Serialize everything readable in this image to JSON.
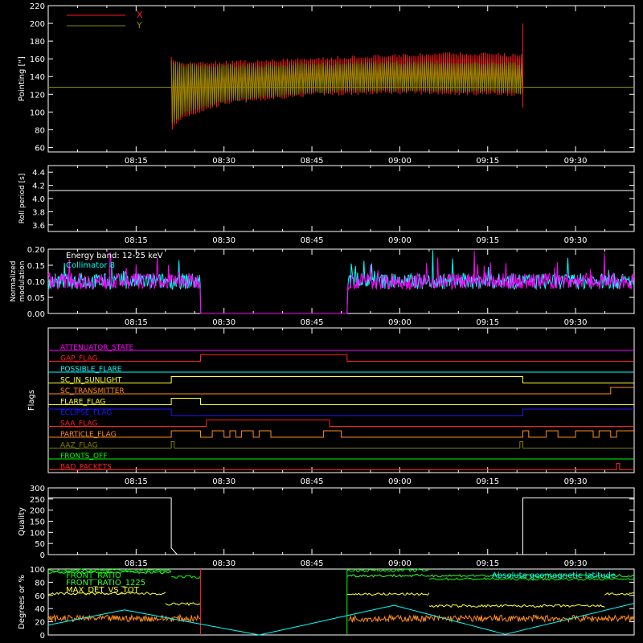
{
  "colors": {
    "background": "#000000",
    "axes": "#ffffff",
    "x_pointing": "#ff1a1a",
    "y_pointing": "#8c8c00",
    "cyan": "#00ffff",
    "magenta": "#ff00ff",
    "yellow": "#ffff33",
    "green": "#00ff00",
    "orange": "#ff8c1a",
    "red": "#ff2020",
    "blue": "#1a1aff",
    "olive": "#808000"
  },
  "time_axis": {
    "ticks": [
      "08:15",
      "08:30",
      "08:45",
      "09:00",
      "09:15",
      "09:30"
    ],
    "tick_minutes_since_08_00": [
      15,
      30,
      45,
      60,
      75,
      90
    ],
    "range_minutes": [
      0,
      100
    ]
  },
  "chart_data": [
    {
      "id": "pointing",
      "type": "line",
      "title": "",
      "xlabel": "",
      "ylabel": "Pointing [\"]",
      "ylim": [
        55,
        220
      ],
      "yticks": [
        "60",
        "80",
        "100",
        "120",
        "140",
        "160",
        "180",
        "200",
        "220"
      ],
      "ytick_values": [
        60,
        80,
        100,
        120,
        140,
        160,
        180,
        200,
        220
      ],
      "legend": "top-left",
      "reference_line": 128,
      "data_start_time": "08:21",
      "data_end_time": "09:21",
      "series": [
        {
          "name": "X",
          "color": "#ff1a1a",
          "x": [
            "08:21",
            "08:23",
            "08:30",
            "08:45",
            "09:00",
            "09:10",
            "09:21"
          ],
          "y_max": [
            162,
            158,
            158,
            162,
            166,
            168,
            166
          ],
          "y_min": [
            78,
            92,
            108,
            118,
            120,
            119,
            118
          ]
        },
        {
          "name": "Y",
          "color": "#8c8c00",
          "x": [
            "08:21",
            "08:23",
            "08:30",
            "08:45",
            "09:00",
            "09:10",
            "09:21"
          ],
          "y_max": [
            160,
            155,
            154,
            156,
            158,
            158,
            156
          ],
          "y_min": [
            84,
            96,
            110,
            120,
            122,
            121,
            120
          ]
        }
      ]
    },
    {
      "id": "roll_period",
      "type": "line",
      "title": "",
      "xlabel": "",
      "ylabel": "Roll period [s]",
      "ylim": [
        3.5,
        4.5
      ],
      "yticks": [
        "3.6",
        "3.8",
        "4.0",
        "4.2",
        "4.4"
      ],
      "ytick_values": [
        3.6,
        3.8,
        4.0,
        4.2,
        4.4
      ],
      "series": [
        {
          "name": "",
          "color": "#ffffff",
          "constant_value": 4.12
        }
      ]
    },
    {
      "id": "modulation",
      "type": "line",
      "title": "",
      "xlabel": "",
      "ylabel": "Normalized modulation",
      "ylabel_lines": [
        "Normalized",
        "modulation"
      ],
      "ylim": [
        0,
        0.2
      ],
      "yticks": [
        "0.00",
        "0.05",
        "0.10",
        "0.15",
        "0.20"
      ],
      "ytick_values": [
        0.0,
        0.05,
        0.1,
        0.15,
        0.2
      ],
      "annotations": [
        "Energy band: 12-25 keV",
        "Collimator 8"
      ],
      "gap_start": "08:26",
      "gap_end": "08:51",
      "series": [
        {
          "name": "Collimator 8",
          "color": "#00ffff",
          "mean": 0.1
        },
        {
          "name": "",
          "color": "#ff00ff",
          "mean": 0.1
        }
      ]
    },
    {
      "id": "flags",
      "type": "line",
      "title": "",
      "xlabel": "",
      "ylabel": "Flags",
      "series": [
        {
          "name": "ATTENUATOR_STATE",
          "color": "#ff00ff",
          "segments": [
            [
              "08:00",
              "09:40",
              0
            ]
          ]
        },
        {
          "name": "GAP_FLAG",
          "color": "#ff2020",
          "segments": [
            [
              "08:00",
              "08:26",
              0
            ],
            [
              "08:26",
              "08:51",
              1
            ],
            [
              "08:51",
              "09:40",
              0
            ]
          ]
        },
        {
          "name": "POSSIBLE_FLARE",
          "color": "#00ffff",
          "segments": [
            [
              "08:00",
              "09:40",
              0
            ]
          ]
        },
        {
          "name": "SC_IN_SUNLIGHT",
          "color": "#ffff33",
          "segments": [
            [
              "08:00",
              "08:21",
              0
            ],
            [
              "08:21",
              "09:21",
              1
            ],
            [
              "09:21",
              "09:40",
              0
            ]
          ]
        },
        {
          "name": "SC_TRANSMITTER",
          "color": "#ff8c1a",
          "segments": [
            [
              "08:00",
              "09:36",
              0
            ],
            [
              "09:36",
              "09:40",
              1
            ]
          ]
        },
        {
          "name": "FLARE_FLAG",
          "color": "#ffff33",
          "segments": [
            [
              "08:00",
              "08:21",
              0
            ],
            [
              "08:21",
              "08:26",
              1
            ],
            [
              "08:26",
              "09:40",
              0
            ]
          ]
        },
        {
          "name": "ECLIPSE_FLAG",
          "color": "#1a1aff",
          "segments": [
            [
              "08:00",
              "08:21",
              1
            ],
            [
              "08:21",
              "09:21",
              0
            ],
            [
              "09:21",
              "09:40",
              1
            ]
          ]
        },
        {
          "name": "SAA_FLAG",
          "color": "#ff2020",
          "segments": [
            [
              "08:00",
              "08:27",
              0
            ],
            [
              "08:27",
              "08:48",
              1
            ],
            [
              "08:48",
              "09:40",
              0
            ]
          ]
        },
        {
          "name": "PARTICLE_FLAG",
          "color": "#ff8c1a",
          "segments": [
            [
              "08:00",
              "08:21",
              0
            ],
            [
              "08:21",
              "08:26",
              1
            ],
            [
              "08:26",
              "08:28",
              0
            ],
            [
              "08:28",
              "08:30",
              1
            ],
            [
              "08:30",
              "08:31",
              0
            ],
            [
              "08:31",
              "08:32",
              1
            ],
            [
              "08:32",
              "08:33",
              0
            ],
            [
              "08:33",
              "08:35",
              1
            ],
            [
              "08:35",
              "08:36",
              0
            ],
            [
              "08:36",
              "08:38",
              1
            ],
            [
              "08:38",
              "08:47",
              0
            ],
            [
              "08:47",
              "08:50",
              1
            ],
            [
              "08:50",
              "09:21",
              0
            ],
            [
              "09:21",
              "09:22",
              1
            ],
            [
              "09:22",
              "09:25",
              0
            ],
            [
              "09:25",
              "09:27",
              1
            ],
            [
              "09:27",
              "09:30",
              0
            ],
            [
              "09:30",
              "09:33",
              1
            ],
            [
              "09:33",
              "09:34",
              0
            ],
            [
              "09:34",
              "09:36",
              1
            ],
            [
              "09:36",
              "09:37",
              0
            ],
            [
              "09:37",
              "09:40",
              1
            ]
          ]
        },
        {
          "name": "AAZ_FLAG",
          "color": "#808000",
          "segments": [
            [
              "08:00",
              "08:21",
              0
            ],
            [
              "08:21",
              "08:21.5",
              1
            ],
            [
              "08:21.5",
              "09:20.5",
              0
            ],
            [
              "09:20.5",
              "09:21",
              1
            ],
            [
              "09:21",
              "09:40",
              0
            ]
          ]
        },
        {
          "name": "FRONTS_OFF",
          "color": "#00ff00",
          "segments": [
            [
              "08:00",
              "09:40",
              0
            ]
          ]
        },
        {
          "name": "BAD_PACKETS",
          "color": "#ff2020",
          "segments": [
            [
              "08:00",
              "09:37",
              0
            ],
            [
              "09:37",
              "09:37.5",
              1
            ],
            [
              "09:37.5",
              "09:40",
              0
            ]
          ]
        }
      ]
    },
    {
      "id": "quality",
      "type": "line",
      "title": "",
      "xlabel": "",
      "ylabel": "Quality",
      "ylim": [
        0,
        300
      ],
      "yticks": [
        "0",
        "50",
        "100",
        "150",
        "200",
        "250",
        "300"
      ],
      "ytick_values": [
        0,
        50,
        100,
        150,
        200,
        250,
        300
      ],
      "series": [
        {
          "name": "",
          "color": "#ffffff",
          "x": [
            "08:00",
            "08:21",
            "08:21",
            "08:22",
            "09:21",
            "09:21",
            "09:40"
          ],
          "y": [
            255,
            255,
            30,
            0,
            0,
            255,
            255
          ]
        }
      ]
    },
    {
      "id": "degrees",
      "type": "line",
      "title": "",
      "xlabel": "",
      "ylabel": "Degrees or %",
      "ylim": [
        0,
        100
      ],
      "yticks": [
        "0",
        "20",
        "40",
        "60",
        "80",
        "100"
      ],
      "ytick_values": [
        0,
        20,
        40,
        60,
        80,
        100
      ],
      "legend": "top-left",
      "series": [
        {
          "name": "FRONT_RATIO",
          "color": "#00ff00",
          "approx": [
            [
              "08:00",
              "08:21",
              98
            ],
            [
              "08:21",
              "08:26",
              88
            ],
            [
              "08:51",
              "09:05",
              98
            ],
            [
              "09:05",
              "09:40",
              85
            ]
          ]
        },
        {
          "name": "FRONT_RATIO_1225",
          "color": "#33ff33",
          "approx": [
            [
              "08:00",
              "08:21",
              95
            ],
            [
              "08:51",
              "09:40",
              90
            ]
          ]
        },
        {
          "name": "MAX_DET_VS_TOT",
          "color": "#ffff33",
          "approx": [
            [
              "08:00",
              "08:20",
              63
            ],
            [
              "08:20",
              "08:26",
              47
            ],
            [
              "08:51",
              "09:05",
              62
            ],
            [
              "09:05",
              "09:35",
              44
            ],
            [
              "09:35",
              "09:40",
              62
            ]
          ]
        },
        {
          "name": "",
          "color": "#ff8c1a",
          "mean": 25
        },
        {
          "name": "Absolute geomagnetic latitude",
          "color": "#00ffff",
          "x": [
            "08:00",
            "08:13",
            "08:36",
            "08:59",
            "09:18",
            "09:40"
          ],
          "y": [
            15,
            38,
            0,
            45,
            1,
            48
          ]
        }
      ]
    }
  ]
}
